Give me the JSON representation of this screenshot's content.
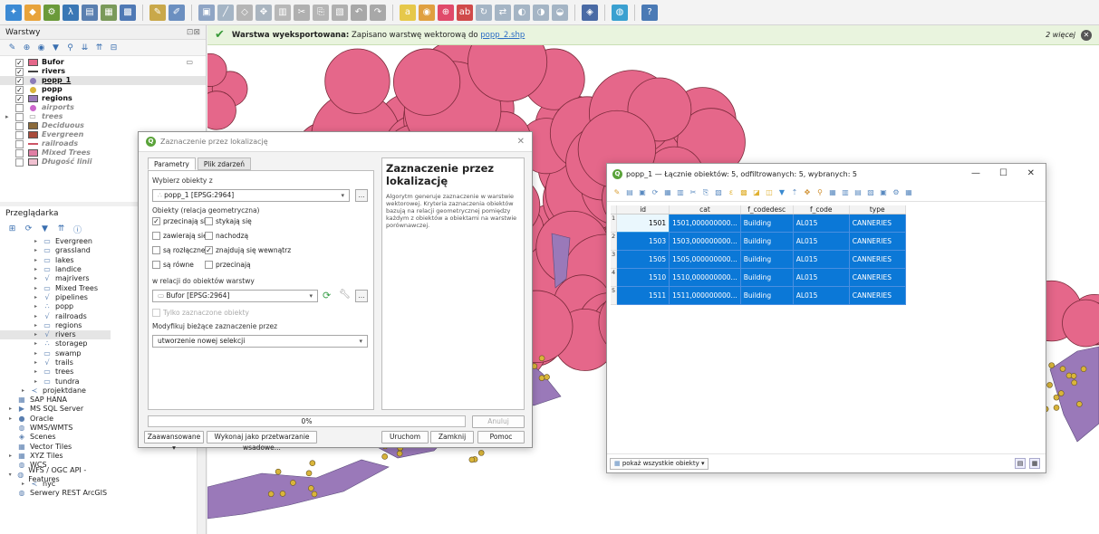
{
  "toolbar": {
    "buttons": [
      {
        "icon": "digitize-icon",
        "color": "#3c8ad4"
      },
      {
        "icon": "vector-layer-icon",
        "color": "#e8a33b"
      },
      {
        "icon": "processing-icon",
        "color": "#6b9a3a"
      },
      {
        "icon": "python-icon",
        "color": "#3a77b5"
      },
      {
        "icon": "layer-properties-icon",
        "color": "#5a7fb0"
      },
      {
        "icon": "table-icon",
        "color": "#7a9a5a"
      },
      {
        "icon": "grid-icon",
        "color": "#4f79b5"
      },
      {
        "icon": "pencil-icon",
        "color": "#c9a84a"
      },
      {
        "icon": "edit-icon",
        "color": "#6b8fc0"
      },
      {
        "icon": "save-edits-icon",
        "color": "#8fa5c5"
      },
      {
        "icon": "add-line-icon",
        "color": "#a5b5c5"
      },
      {
        "icon": "node-tool-icon",
        "color": "#b5b5b5"
      },
      {
        "icon": "move-feature-icon",
        "color": "#aab5c0"
      },
      {
        "icon": "delete-icon",
        "color": "#b8b8b8"
      },
      {
        "icon": "cut-icon",
        "color": "#b0b0b0"
      },
      {
        "icon": "copy-icon",
        "color": "#b5b5b5"
      },
      {
        "icon": "paste-icon",
        "color": "#b0b0b0"
      },
      {
        "icon": "undo-icon",
        "color": "#a8a8a8"
      },
      {
        "icon": "redo-icon",
        "color": "#a8a8a8"
      },
      {
        "icon": "label-icon",
        "color": "#e6c84a"
      },
      {
        "icon": "label-style-icon",
        "color": "#e0a040"
      },
      {
        "icon": "label-pin-icon",
        "color": "#e04a6a"
      },
      {
        "icon": "label-abc-icon",
        "color": "#d04a4a"
      },
      {
        "icon": "label-rotate-icon",
        "color": "#a5b5c5"
      },
      {
        "icon": "label-move-icon",
        "color": "#a5b5c5"
      },
      {
        "icon": "label-show-icon",
        "color": "#a5b5c5"
      },
      {
        "icon": "label-change-icon",
        "color": "#a5b5c5"
      },
      {
        "icon": "label-hide-icon",
        "color": "#a5b5c5"
      },
      {
        "icon": "plugin-icon",
        "color": "#4a6ba5"
      },
      {
        "icon": "globe-plugin-icon",
        "color": "#3aa0d0"
      },
      {
        "icon": "help-icon",
        "color": "#4a7ab5"
      }
    ]
  },
  "layers": {
    "title": "Warstwy",
    "header_icons": "⊡⊠",
    "items": [
      {
        "name": "Bufor",
        "checked": true,
        "symbol": "fill",
        "color": "#e5678a",
        "active": true,
        "style": "bold"
      },
      {
        "name": "rivers",
        "checked": true,
        "symbol": "line",
        "color": "#444444",
        "active": true,
        "style": "bold"
      },
      {
        "name": "popp_1",
        "checked": true,
        "symbol": "point",
        "color": "#8b7bb8",
        "active": true,
        "style": "bold-underline"
      },
      {
        "name": "popp",
        "checked": true,
        "symbol": "point",
        "color": "#d9b53a",
        "active": true,
        "style": "bold"
      },
      {
        "name": "regions",
        "checked": true,
        "symbol": "fill",
        "color": "#9a79b9",
        "active": true,
        "style": "bold"
      },
      {
        "name": "airports",
        "checked": false,
        "symbol": "point",
        "color": "#cc66cc",
        "active": false,
        "style": "off"
      },
      {
        "name": "trees",
        "checked": false,
        "symbol": "group",
        "color": "#999999",
        "active": false,
        "style": "off"
      },
      {
        "name": "Deciduous",
        "checked": false,
        "symbol": "fill",
        "color": "#8b6a3a",
        "active": false,
        "style": "off"
      },
      {
        "name": "Evergreen",
        "checked": false,
        "symbol": "fill",
        "color": "#a84a3a",
        "active": false,
        "style": "off"
      },
      {
        "name": "railroads",
        "checked": false,
        "symbol": "line",
        "color": "#cc5566",
        "active": false,
        "style": "off"
      },
      {
        "name": "Mixed Trees",
        "checked": false,
        "symbol": "fill",
        "color": "#e07fa5",
        "active": false,
        "style": "off"
      },
      {
        "name": "Długość linii",
        "checked": false,
        "symbol": "fill",
        "color": "#f0c0d0",
        "active": false,
        "style": "off"
      }
    ]
  },
  "browser": {
    "title": "Przeglądarka",
    "items": [
      {
        "label": "Evergreen",
        "indent": 2,
        "icon": "▭",
        "exp": "▸"
      },
      {
        "label": "grassland",
        "indent": 2,
        "icon": "▭",
        "exp": "▸"
      },
      {
        "label": "lakes",
        "indent": 2,
        "icon": "▭",
        "exp": "▸"
      },
      {
        "label": "landice",
        "indent": 2,
        "icon": "▭",
        "exp": "▸"
      },
      {
        "label": "majrivers",
        "indent": 2,
        "icon": "√",
        "exp": "▸"
      },
      {
        "label": "Mixed Trees",
        "indent": 2,
        "icon": "▭",
        "exp": "▸"
      },
      {
        "label": "pipelines",
        "indent": 2,
        "icon": "√",
        "exp": "▸"
      },
      {
        "label": "popp",
        "indent": 2,
        "icon": "∴",
        "exp": "▸"
      },
      {
        "label": "railroads",
        "indent": 2,
        "icon": "√",
        "exp": "▸"
      },
      {
        "label": "regions",
        "indent": 2,
        "icon": "▭",
        "exp": "▸"
      },
      {
        "label": "rivers",
        "indent": 2,
        "icon": "√",
        "exp": "▸",
        "hl": true
      },
      {
        "label": "storagep",
        "indent": 2,
        "icon": "∴",
        "exp": "▸"
      },
      {
        "label": "swamp",
        "indent": 2,
        "icon": "▭",
        "exp": "▸"
      },
      {
        "label": "trails",
        "indent": 2,
        "icon": "√",
        "exp": "▸"
      },
      {
        "label": "trees",
        "indent": 2,
        "icon": "▭",
        "exp": "▸"
      },
      {
        "label": "tundra",
        "indent": 2,
        "icon": "▭",
        "exp": "▸"
      },
      {
        "label": "projektdane",
        "indent": 1,
        "icon": "≺",
        "exp": "▸"
      },
      {
        "label": "SAP HANA",
        "indent": 0,
        "icon": "▦",
        "exp": ""
      },
      {
        "label": "MS SQL Server",
        "indent": 0,
        "icon": "▶",
        "exp": "▸"
      },
      {
        "label": "Oracle",
        "indent": 0,
        "icon": "●",
        "exp": "▸"
      },
      {
        "label": "WMS/WMTS",
        "indent": 0,
        "icon": "◍",
        "exp": ""
      },
      {
        "label": "Scenes",
        "indent": 0,
        "icon": "◈",
        "exp": ""
      },
      {
        "label": "Vector Tiles",
        "indent": 0,
        "icon": "▦",
        "exp": ""
      },
      {
        "label": "XYZ Tiles",
        "indent": 0,
        "icon": "▦",
        "exp": "▸"
      },
      {
        "label": "WCS",
        "indent": 0,
        "icon": "◍",
        "exp": ""
      },
      {
        "label": "WFS / OGC API - Features",
        "indent": 0,
        "icon": "◍",
        "exp": "▾"
      },
      {
        "label": "nyc",
        "indent": 1,
        "icon": "≺",
        "exp": "▸"
      },
      {
        "label": "Serwery REST ArcGIS",
        "indent": 0,
        "icon": "◍",
        "exp": ""
      }
    ]
  },
  "message": {
    "bold": "Warstwa wyeksportowana:",
    "text": "Zapisano warstwę wektorową do",
    "link": "popp_2.shp",
    "more": "2 więcej"
  },
  "dialog": {
    "title": "Zaznaczenie przez lokalizację",
    "tab_params": "Parametry",
    "tab_log": "Plik zdarzeń",
    "select_features_label": "Wybierz obiekty z",
    "select_features_value": "popp_1 [EPSG:2964]",
    "predicate_label": "Obiekty (relacja geometryczna)",
    "predicates": [
      {
        "label": "przecinają się",
        "checked": true
      },
      {
        "label": "stykają się",
        "checked": false
      },
      {
        "label": "zawierają się",
        "checked": false
      },
      {
        "label": "nachodzą",
        "checked": false
      },
      {
        "label": "są rozłączne",
        "checked": false
      },
      {
        "label": "znajdują się wewnątrz",
        "checked": true
      },
      {
        "label": "są równe",
        "checked": false
      },
      {
        "label": "przecinają",
        "checked": false
      }
    ],
    "compare_label": "w relacji do obiektów warstwy",
    "compare_value": "Bufor [EPSG:2964]",
    "selected_only": "Tylko zaznaczone obiekty",
    "modify_label": "Modyfikuj bieżące zaznaczenie przez",
    "modify_value": "utworzenie nowej selekcji",
    "help_title": "Zaznaczenie przez lokalizację",
    "help_text": "Algorytm generuje zaznaczenie w warstwie wektorowej. Kryteria zaznaczenia obiektów bazują na relacji geometrycznej pomiędzy każdym z obiektów a obiektami na warstwie porównawczej.",
    "progress": "0%",
    "cancel": "Anuluj",
    "advanced": "Zaawansowane",
    "batch": "Wykonaj jako przetwarzanie wsadowe...",
    "run": "Uruchom",
    "close": "Zamknij",
    "help": "Pomoc"
  },
  "attribute_table": {
    "title": "popp_1 — Łącznie obiektów: 5, odfiltrowanych: 5, wybranych: 5",
    "columns": [
      "id",
      "cat",
      "f_codedesc",
      "f_code",
      "type"
    ],
    "rows": [
      [
        "1501",
        "1501,000000000...",
        "Building",
        "AL015",
        "CANNERIES"
      ],
      [
        "1503",
        "1503,000000000...",
        "Building",
        "AL015",
        "CANNERIES"
      ],
      [
        "1505",
        "1505,000000000...",
        "Building",
        "AL015",
        "CANNERIES"
      ],
      [
        "1510",
        "1510,000000000...",
        "Building",
        "AL015",
        "CANNERIES"
      ],
      [
        "1511",
        "1511,000000000...",
        "Building",
        "AL015",
        "CANNERIES"
      ]
    ],
    "filter_label": "pokaż wszystkie obiekty"
  },
  "colors": {
    "buffer": "#e5678a",
    "buffer_stroke": "#7a2a3a",
    "region": "#9a79b9",
    "point": "#d9b53a",
    "selection": "#0b78d7"
  }
}
